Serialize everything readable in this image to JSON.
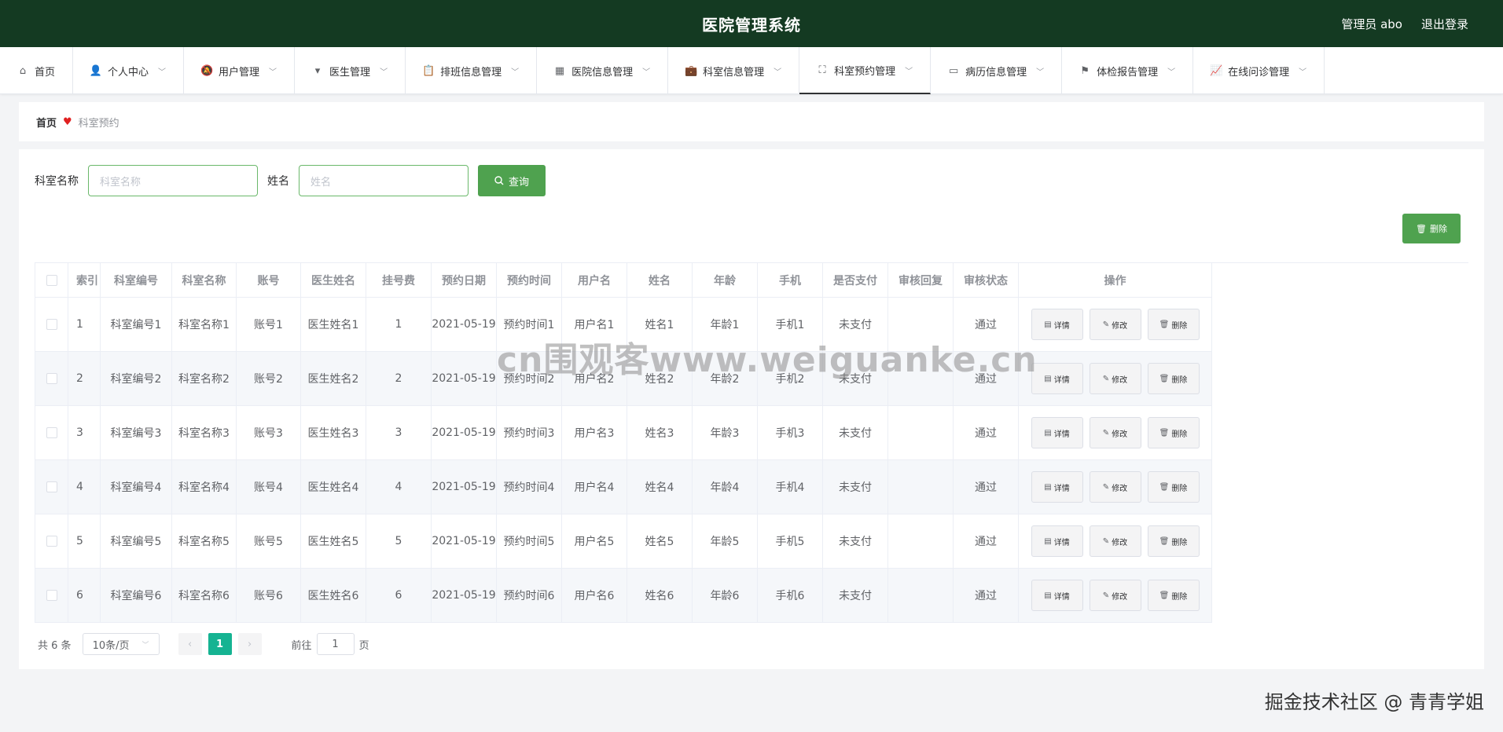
{
  "header": {
    "title": "医院管理系统",
    "user": "管理员 abo",
    "logout": "退出登录"
  },
  "nav": [
    {
      "label": "首页",
      "icon": "home-icon",
      "has_menu": false
    },
    {
      "label": "个人中心",
      "icon": "user-icon",
      "has_menu": true
    },
    {
      "label": "用户管理",
      "icon": "bell-off-icon",
      "has_menu": true
    },
    {
      "label": "医生管理",
      "icon": "brush-icon",
      "has_menu": true
    },
    {
      "label": "排班信息管理",
      "icon": "clipboard-icon",
      "has_menu": true
    },
    {
      "label": "医院信息管理",
      "icon": "grid-icon",
      "has_menu": true
    },
    {
      "label": "科室信息管理",
      "icon": "briefcase-icon",
      "has_menu": true
    },
    {
      "label": "科室预约管理",
      "icon": "fullscreen-icon",
      "has_menu": true,
      "active": true
    },
    {
      "label": "病历信息管理",
      "icon": "id-card-icon",
      "has_menu": true
    },
    {
      "label": "体检报告管理",
      "icon": "flag-icon",
      "has_menu": true
    },
    {
      "label": "在线问诊管理",
      "icon": "chart-icon",
      "has_menu": true
    }
  ],
  "breadcrumb": {
    "home": "首页",
    "current": "科室预约"
  },
  "search": {
    "dept_label": "科室名称",
    "dept_placeholder": "科室名称",
    "name_label": "姓名",
    "name_placeholder": "姓名",
    "query_button": "查询"
  },
  "delete_button": "删除",
  "table": {
    "columns": [
      "索引",
      "科室编号",
      "科室名称",
      "账号",
      "医生姓名",
      "挂号费",
      "预约日期",
      "预约时间",
      "用户名",
      "姓名",
      "年龄",
      "手机",
      "是否支付",
      "审核回复",
      "审核状态",
      "操作"
    ],
    "rows": [
      [
        "1",
        "科室编号1",
        "科室名称1",
        "账号1",
        "医生姓名1",
        "1",
        "2021-05-19",
        "预约时间1",
        "用户名1",
        "姓名1",
        "年龄1",
        "手机1",
        "未支付",
        "",
        "通过"
      ],
      [
        "2",
        "科室编号2",
        "科室名称2",
        "账号2",
        "医生姓名2",
        "2",
        "2021-05-19",
        "预约时间2",
        "用户名2",
        "姓名2",
        "年龄2",
        "手机2",
        "未支付",
        "",
        "通过"
      ],
      [
        "3",
        "科室编号3",
        "科室名称3",
        "账号3",
        "医生姓名3",
        "3",
        "2021-05-19",
        "预约时间3",
        "用户名3",
        "姓名3",
        "年龄3",
        "手机3",
        "未支付",
        "",
        "通过"
      ],
      [
        "4",
        "科室编号4",
        "科室名称4",
        "账号4",
        "医生姓名4",
        "4",
        "2021-05-19",
        "预约时间4",
        "用户名4",
        "姓名4",
        "年龄4",
        "手机4",
        "未支付",
        "",
        "通过"
      ],
      [
        "5",
        "科室编号5",
        "科室名称5",
        "账号5",
        "医生姓名5",
        "5",
        "2021-05-19",
        "预约时间5",
        "用户名5",
        "姓名5",
        "年龄5",
        "手机5",
        "未支付",
        "",
        "通过"
      ],
      [
        "6",
        "科室编号6",
        "科室名称6",
        "账号6",
        "医生姓名6",
        "6",
        "2021-05-19",
        "预约时间6",
        "用户名6",
        "姓名6",
        "年龄6",
        "手机6",
        "未支付",
        "",
        "通过"
      ]
    ],
    "actions": {
      "detail": "详情",
      "edit": "修改",
      "delete": "删除"
    }
  },
  "pagination": {
    "total": "共 6 条",
    "page_size": "10条/页",
    "current": "1",
    "goto_prefix": "前往",
    "goto_value": "1",
    "goto_suffix": "页"
  },
  "watermark": "cn围观客www.weiguanke.cn",
  "credit": "掘金技术社区 @ 青青学姐",
  "colors": {
    "header_bg": "#143a22",
    "accent": "#4fa24f",
    "page_active": "#15b392"
  }
}
